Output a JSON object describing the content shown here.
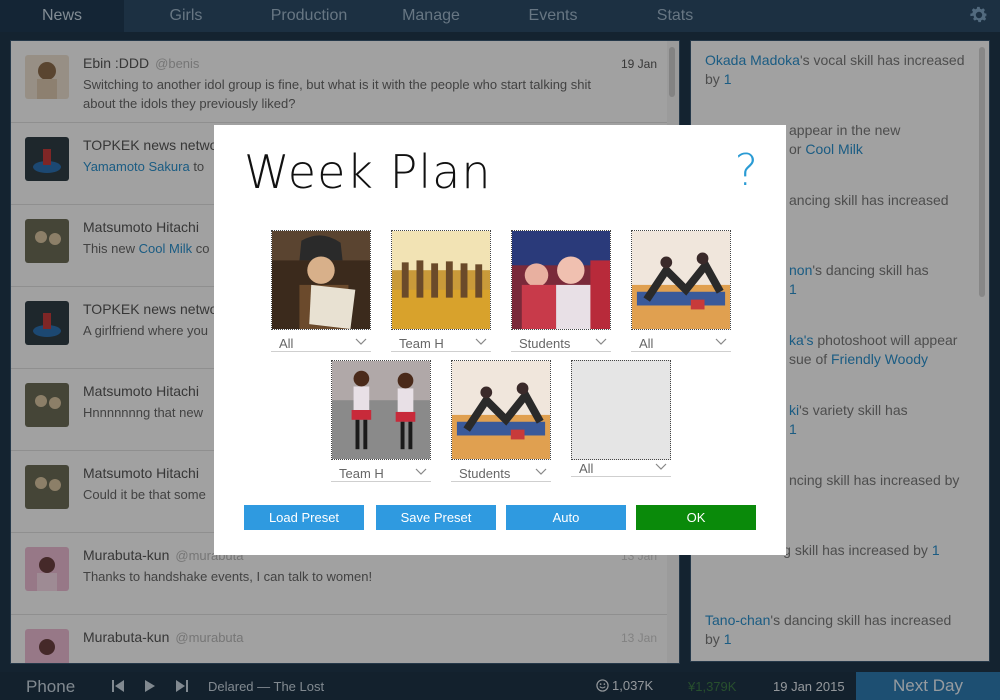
{
  "nav": {
    "tabs": [
      {
        "label": "News",
        "active": true
      },
      {
        "label": "Girls",
        "active": false
      },
      {
        "label": "Production",
        "active": false
      },
      {
        "label": "Manage",
        "active": false
      },
      {
        "label": "Events",
        "active": false
      },
      {
        "label": "Stats",
        "active": false
      }
    ],
    "settings_icon": "gear-icon"
  },
  "feed": {
    "posts": [
      {
        "name": "Ebin :DDD",
        "handle": "@benis",
        "date": "19 Jan",
        "text": "Switching to another idol group is fine, but what is it with the people who start talking shit about the idols they previously liked?",
        "link": "",
        "after": ""
      },
      {
        "name": "TOPKEK news netwo",
        "handle": "",
        "date": "",
        "text": "",
        "link": "Yamamoto Sakura",
        "after": " to"
      },
      {
        "name": "Matsumoto Hitachi",
        "handle": "",
        "date": "",
        "text": "This new ",
        "link": "Cool Milk",
        "after": " co"
      },
      {
        "name": "TOPKEK news netwo",
        "handle": "",
        "date": "",
        "text": "A girlfriend where you",
        "link": "",
        "after": ""
      },
      {
        "name": "Matsumoto Hitachi",
        "handle": "",
        "date": "",
        "text": "Hnnnnnnng that new",
        "link": "",
        "after": ""
      },
      {
        "name": "Matsumoto Hitachi",
        "handle": "",
        "date": "",
        "text": "Could it be that some",
        "link": "",
        "after": ""
      },
      {
        "name": "Murabuta-kun",
        "handle": "@murabuta",
        "date": "13 Jan",
        "text": "Thanks to handshake events, I can talk to women!",
        "link": "",
        "after": ""
      },
      {
        "name": "Murabuta-kun",
        "handle": "@murabuta",
        "date": "13 Jan",
        "text": "",
        "link": "",
        "after": ""
      }
    ]
  },
  "notifications": [
    {
      "pre": "",
      "link": "Okada Madoka",
      "mid": "'s vocal skill has increased by ",
      "link2": "1",
      "post": ""
    },
    {
      "pre": "",
      "link": "",
      "mid": "appear in the new",
      "link2": "",
      "post": ""
    },
    {
      "pre": "",
      "link": "",
      "mid": "or ",
      "link2": "Cool Milk",
      "post": ""
    },
    {
      "pre": "",
      "link": "",
      "mid": "ancing skill has increased",
      "link2": "",
      "post": ""
    },
    {
      "pre": "",
      "link": "non",
      "mid": "'s dancing skill has",
      "link2": "",
      "post": ""
    },
    {
      "pre": "",
      "link": "",
      "mid": "",
      "link2": "1",
      "post": ""
    },
    {
      "pre": "",
      "link": "ka's",
      "mid": " photoshoot will appear",
      "link2": "",
      "post": ""
    },
    {
      "pre": "",
      "link": "",
      "mid": "sue of ",
      "link2": "Friendly Woody",
      "post": ""
    },
    {
      "pre": "",
      "link": "ki",
      "mid": "'s variety skill has",
      "link2": "",
      "post": ""
    },
    {
      "pre": "",
      "link": "",
      "mid": "",
      "link2": "1",
      "post": ""
    },
    {
      "pre": "",
      "link": "",
      "mid": "ncing skill has increased by",
      "link2": "",
      "post": ""
    },
    {
      "pre": "",
      "link": "non",
      "mid": "'s dancing skill has increased by ",
      "link2": "1",
      "post": ""
    },
    {
      "pre": "",
      "link": "Tano-chan",
      "mid": "'s dancing skill has increased by ",
      "link2": "1",
      "post": ""
    }
  ],
  "bottom": {
    "phone_label": "Phone",
    "song": "Delared — The Lost",
    "fans": "1,037K",
    "money": "¥1,379K",
    "date": "19 Jan 2015",
    "next_day_label": "Next Day"
  },
  "modal": {
    "title": "Week Plan",
    "help_glyph": "?",
    "slots": [
      {
        "value": "All",
        "image": "reading-girl"
      },
      {
        "value": "Team H",
        "image": "dance-studio"
      },
      {
        "value": "Students",
        "image": "crowd-stage"
      },
      {
        "value": "All",
        "image": "dance-floor"
      },
      {
        "value": "Team H",
        "image": "street-idols"
      },
      {
        "value": "Students",
        "image": "dance-floor"
      },
      {
        "value": "All",
        "image": "empty"
      }
    ],
    "buttons": {
      "load_preset": "Load Preset",
      "save_preset": "Save Preset",
      "auto": "Auto",
      "ok": "OK"
    },
    "colors": {
      "blue_button": "#2f9ae0",
      "ok_button": "#0a8a0a",
      "help": "#2a9bd4"
    }
  }
}
